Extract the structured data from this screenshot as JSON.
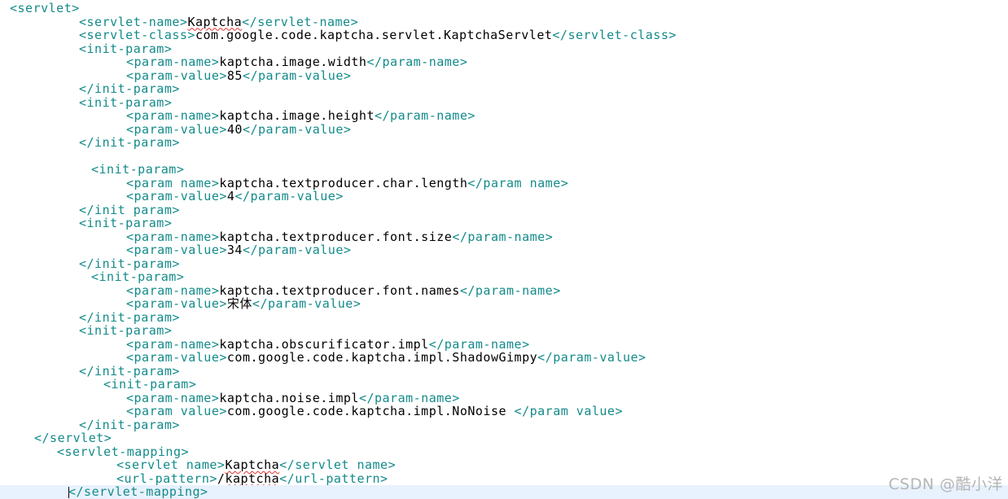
{
  "editor": {
    "lines": [
      {
        "indent": 12,
        "parts": [
          [
            "t",
            "<servlet>"
          ]
        ]
      },
      {
        "indent": 97,
        "parts": [
          [
            "t",
            "<servlet-name>"
          ],
          [
            "s",
            "Kaptcha"
          ],
          [
            "t",
            "</servlet-name>"
          ]
        ]
      },
      {
        "indent": 97,
        "parts": [
          [
            "t",
            "<servlet-class>"
          ],
          [
            "x",
            "com.google.code.kaptcha.servlet.KaptchaServlet"
          ],
          [
            "t",
            "</servlet-class>"
          ]
        ]
      },
      {
        "indent": 97,
        "parts": [
          [
            "t",
            "<init-param>"
          ]
        ]
      },
      {
        "indent": 155,
        "parts": [
          [
            "t",
            "<param-name>"
          ],
          [
            "x",
            "kaptcha.image.width"
          ],
          [
            "t",
            "</param-name>"
          ]
        ]
      },
      {
        "indent": 155,
        "parts": [
          [
            "t",
            "<param-value>"
          ],
          [
            "x",
            "85"
          ],
          [
            "t",
            "</param-value>"
          ]
        ]
      },
      {
        "indent": 97,
        "parts": [
          [
            "t",
            "</init-param>"
          ]
        ]
      },
      {
        "indent": 97,
        "parts": [
          [
            "t",
            "<init-param>"
          ]
        ]
      },
      {
        "indent": 155,
        "parts": [
          [
            "t",
            "<param-name>"
          ],
          [
            "x",
            "kaptcha.image.height"
          ],
          [
            "t",
            "</param-name>"
          ]
        ]
      },
      {
        "indent": 155,
        "parts": [
          [
            "t",
            "<param-value>"
          ],
          [
            "x",
            "40"
          ],
          [
            "t",
            "</param-value>"
          ]
        ]
      },
      {
        "indent": 97,
        "parts": [
          [
            "t",
            "</init-param>"
          ]
        ]
      },
      {
        "indent": 0,
        "parts": []
      },
      {
        "indent": 112,
        "parts": [
          [
            "t",
            "<init-param>"
          ]
        ]
      },
      {
        "indent": 155,
        "parts": [
          [
            "t",
            "<param name>"
          ],
          [
            "x",
            "kaptcha.textproducer.char.length"
          ],
          [
            "t",
            "</param name>"
          ]
        ]
      },
      {
        "indent": 155,
        "parts": [
          [
            "t",
            "<param-value>"
          ],
          [
            "x",
            "4"
          ],
          [
            "t",
            "</param-value>"
          ]
        ]
      },
      {
        "indent": 97,
        "parts": [
          [
            "t",
            "</init param>"
          ]
        ]
      },
      {
        "indent": 97,
        "parts": [
          [
            "t",
            "<init-param>"
          ]
        ]
      },
      {
        "indent": 155,
        "parts": [
          [
            "t",
            "<param-name>"
          ],
          [
            "x",
            "kaptcha.textproducer.font.size"
          ],
          [
            "t",
            "</param-name>"
          ]
        ]
      },
      {
        "indent": 155,
        "parts": [
          [
            "t",
            "<param-value>"
          ],
          [
            "x",
            "34"
          ],
          [
            "t",
            "</param-value>"
          ]
        ]
      },
      {
        "indent": 97,
        "parts": [
          [
            "t",
            "</init-param>"
          ]
        ]
      },
      {
        "indent": 112,
        "parts": [
          [
            "t",
            "<init-param>"
          ]
        ]
      },
      {
        "indent": 155,
        "parts": [
          [
            "t",
            "<param-name>"
          ],
          [
            "x",
            "kaptcha.textproducer.font.names"
          ],
          [
            "t",
            "</param-name>"
          ]
        ]
      },
      {
        "indent": 155,
        "parts": [
          [
            "t",
            "<param-value>"
          ],
          [
            "x",
            "宋体"
          ],
          [
            "t",
            "</param-value>"
          ]
        ]
      },
      {
        "indent": 97,
        "parts": [
          [
            "t",
            "</init-param>"
          ]
        ]
      },
      {
        "indent": 97,
        "parts": [
          [
            "t",
            "<init-param>"
          ]
        ]
      },
      {
        "indent": 155,
        "parts": [
          [
            "t",
            "<param-name>"
          ],
          [
            "x",
            "kaptcha.obscurificator.impl"
          ],
          [
            "t",
            "</param-name>"
          ]
        ]
      },
      {
        "indent": 155,
        "parts": [
          [
            "t",
            "<param-value>"
          ],
          [
            "x",
            "com.google.code.kaptcha.impl.ShadowGimpy"
          ],
          [
            "t",
            "</param-value>"
          ]
        ]
      },
      {
        "indent": 97,
        "parts": [
          [
            "t",
            "</init-param>"
          ]
        ]
      },
      {
        "indent": 127,
        "parts": [
          [
            "t",
            "<init-param>"
          ]
        ]
      },
      {
        "indent": 155,
        "parts": [
          [
            "t",
            "<param-name>"
          ],
          [
            "x",
            "kaptcha.noise.impl"
          ],
          [
            "t",
            "</param-name>"
          ]
        ]
      },
      {
        "indent": 155,
        "parts": [
          [
            "t",
            "<param value>"
          ],
          [
            "x",
            "com.google.code.kaptcha.impl.NoNoise "
          ],
          [
            "t",
            "</param value>"
          ]
        ]
      },
      {
        "indent": 97,
        "parts": [
          [
            "t",
            "</init-param>"
          ]
        ]
      },
      {
        "indent": 42,
        "parts": [
          [
            "t",
            "</servlet>"
          ]
        ]
      },
      {
        "indent": 70,
        "parts": [
          [
            "t",
            "<servlet-mapping>"
          ]
        ]
      },
      {
        "indent": 143,
        "parts": [
          [
            "t",
            "<servlet name>"
          ],
          [
            "s",
            "Kaptcha"
          ],
          [
            "t",
            "</servlet name>"
          ]
        ]
      },
      {
        "indent": 143,
        "parts": [
          [
            "t",
            "<url-pattern>"
          ],
          [
            "x",
            "/"
          ],
          [
            "s",
            "kaptcha"
          ],
          [
            "t",
            "</url-pattern>"
          ]
        ]
      },
      {
        "indent": 84,
        "current": true,
        "cursor": true,
        "parts": [
          [
            "t",
            "</servlet-mapping>"
          ]
        ]
      }
    ]
  },
  "watermark": "CSDN @酷小洋",
  "colors": {
    "tag": "#138a8a",
    "text": "#000000",
    "current_line": "#e8f2fe",
    "spellcheck": "#e03030"
  }
}
